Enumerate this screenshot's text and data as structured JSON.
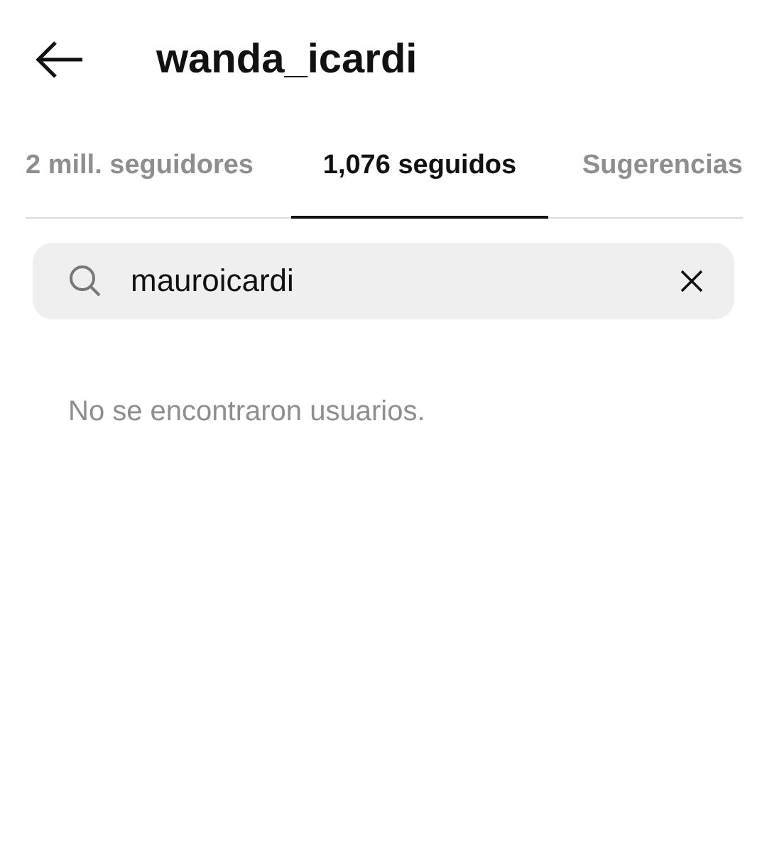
{
  "header": {
    "title": "wanda_icardi"
  },
  "tabs": [
    {
      "label": "2 mill. seguidores",
      "selected": false
    },
    {
      "label": "1,076 seguidos",
      "selected": true
    },
    {
      "label": "Sugerencias",
      "selected": false
    }
  ],
  "search": {
    "value": "mauroicardi"
  },
  "empty_message": "No se encontraron usuarios."
}
